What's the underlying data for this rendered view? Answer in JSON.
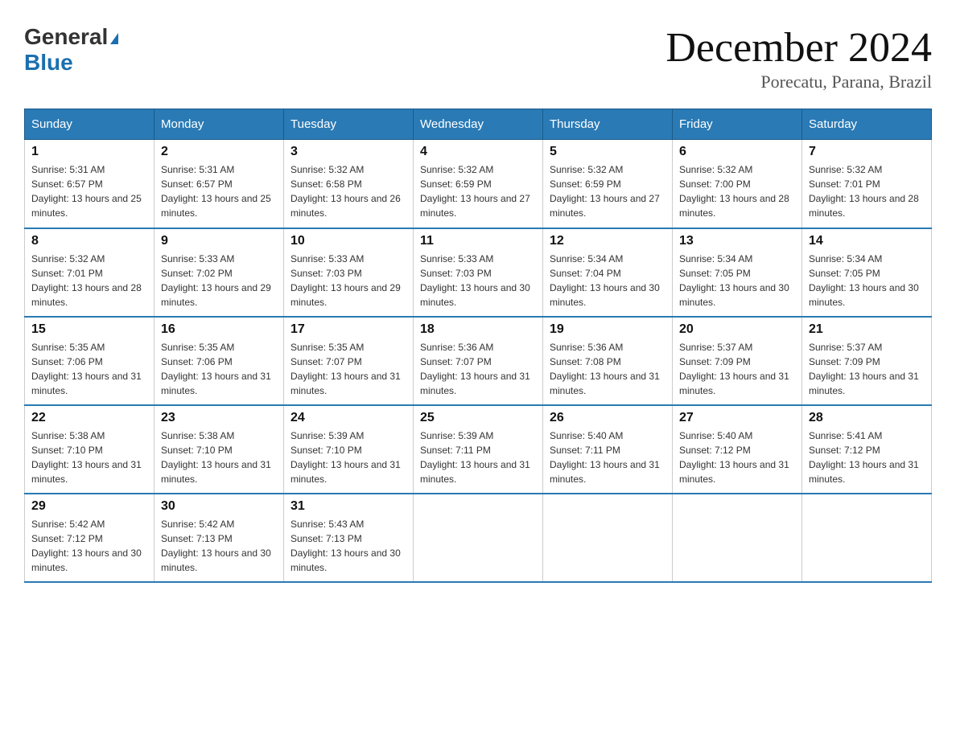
{
  "logo": {
    "general": "General",
    "blue": "Blue",
    "triangle": "▶"
  },
  "header": {
    "month_year": "December 2024",
    "location": "Porecatu, Parana, Brazil"
  },
  "columns": [
    "Sunday",
    "Monday",
    "Tuesday",
    "Wednesday",
    "Thursday",
    "Friday",
    "Saturday"
  ],
  "weeks": [
    [
      {
        "day": "1",
        "sunrise": "5:31 AM",
        "sunset": "6:57 PM",
        "daylight": "13 hours and 25 minutes."
      },
      {
        "day": "2",
        "sunrise": "5:31 AM",
        "sunset": "6:57 PM",
        "daylight": "13 hours and 25 minutes."
      },
      {
        "day": "3",
        "sunrise": "5:32 AM",
        "sunset": "6:58 PM",
        "daylight": "13 hours and 26 minutes."
      },
      {
        "day": "4",
        "sunrise": "5:32 AM",
        "sunset": "6:59 PM",
        "daylight": "13 hours and 27 minutes."
      },
      {
        "day": "5",
        "sunrise": "5:32 AM",
        "sunset": "6:59 PM",
        "daylight": "13 hours and 27 minutes."
      },
      {
        "day": "6",
        "sunrise": "5:32 AM",
        "sunset": "7:00 PM",
        "daylight": "13 hours and 28 minutes."
      },
      {
        "day": "7",
        "sunrise": "5:32 AM",
        "sunset": "7:01 PM",
        "daylight": "13 hours and 28 minutes."
      }
    ],
    [
      {
        "day": "8",
        "sunrise": "5:32 AM",
        "sunset": "7:01 PM",
        "daylight": "13 hours and 28 minutes."
      },
      {
        "day": "9",
        "sunrise": "5:33 AM",
        "sunset": "7:02 PM",
        "daylight": "13 hours and 29 minutes."
      },
      {
        "day": "10",
        "sunrise": "5:33 AM",
        "sunset": "7:03 PM",
        "daylight": "13 hours and 29 minutes."
      },
      {
        "day": "11",
        "sunrise": "5:33 AM",
        "sunset": "7:03 PM",
        "daylight": "13 hours and 30 minutes."
      },
      {
        "day": "12",
        "sunrise": "5:34 AM",
        "sunset": "7:04 PM",
        "daylight": "13 hours and 30 minutes."
      },
      {
        "day": "13",
        "sunrise": "5:34 AM",
        "sunset": "7:05 PM",
        "daylight": "13 hours and 30 minutes."
      },
      {
        "day": "14",
        "sunrise": "5:34 AM",
        "sunset": "7:05 PM",
        "daylight": "13 hours and 30 minutes."
      }
    ],
    [
      {
        "day": "15",
        "sunrise": "5:35 AM",
        "sunset": "7:06 PM",
        "daylight": "13 hours and 31 minutes."
      },
      {
        "day": "16",
        "sunrise": "5:35 AM",
        "sunset": "7:06 PM",
        "daylight": "13 hours and 31 minutes."
      },
      {
        "day": "17",
        "sunrise": "5:35 AM",
        "sunset": "7:07 PM",
        "daylight": "13 hours and 31 minutes."
      },
      {
        "day": "18",
        "sunrise": "5:36 AM",
        "sunset": "7:07 PM",
        "daylight": "13 hours and 31 minutes."
      },
      {
        "day": "19",
        "sunrise": "5:36 AM",
        "sunset": "7:08 PM",
        "daylight": "13 hours and 31 minutes."
      },
      {
        "day": "20",
        "sunrise": "5:37 AM",
        "sunset": "7:09 PM",
        "daylight": "13 hours and 31 minutes."
      },
      {
        "day": "21",
        "sunrise": "5:37 AM",
        "sunset": "7:09 PM",
        "daylight": "13 hours and 31 minutes."
      }
    ],
    [
      {
        "day": "22",
        "sunrise": "5:38 AM",
        "sunset": "7:10 PM",
        "daylight": "13 hours and 31 minutes."
      },
      {
        "day": "23",
        "sunrise": "5:38 AM",
        "sunset": "7:10 PM",
        "daylight": "13 hours and 31 minutes."
      },
      {
        "day": "24",
        "sunrise": "5:39 AM",
        "sunset": "7:10 PM",
        "daylight": "13 hours and 31 minutes."
      },
      {
        "day": "25",
        "sunrise": "5:39 AM",
        "sunset": "7:11 PM",
        "daylight": "13 hours and 31 minutes."
      },
      {
        "day": "26",
        "sunrise": "5:40 AM",
        "sunset": "7:11 PM",
        "daylight": "13 hours and 31 minutes."
      },
      {
        "day": "27",
        "sunrise": "5:40 AM",
        "sunset": "7:12 PM",
        "daylight": "13 hours and 31 minutes."
      },
      {
        "day": "28",
        "sunrise": "5:41 AM",
        "sunset": "7:12 PM",
        "daylight": "13 hours and 31 minutes."
      }
    ],
    [
      {
        "day": "29",
        "sunrise": "5:42 AM",
        "sunset": "7:12 PM",
        "daylight": "13 hours and 30 minutes."
      },
      {
        "day": "30",
        "sunrise": "5:42 AM",
        "sunset": "7:13 PM",
        "daylight": "13 hours and 30 minutes."
      },
      {
        "day": "31",
        "sunrise": "5:43 AM",
        "sunset": "7:13 PM",
        "daylight": "13 hours and 30 minutes."
      },
      null,
      null,
      null,
      null
    ]
  ],
  "labels": {
    "sunrise_prefix": "Sunrise: ",
    "sunset_prefix": "Sunset: ",
    "daylight_prefix": "Daylight: "
  }
}
